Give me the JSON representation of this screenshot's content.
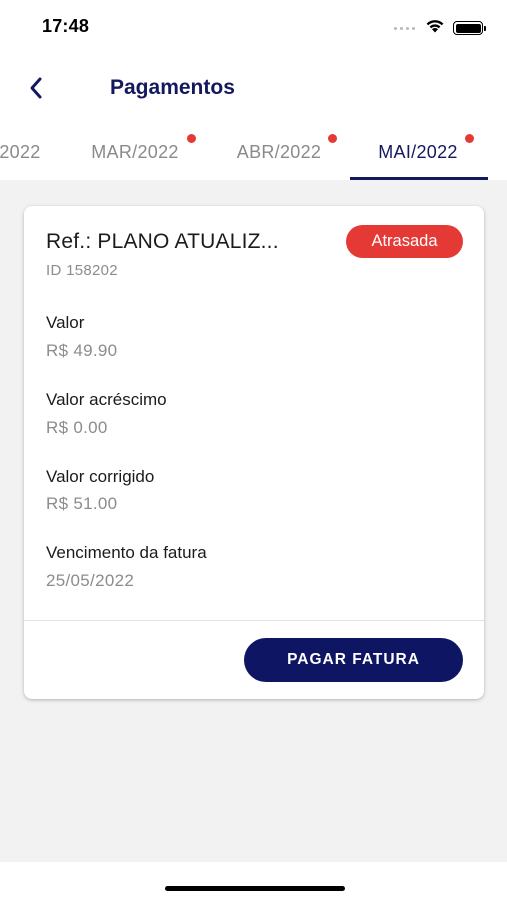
{
  "status_bar": {
    "time": "17:48",
    "icons": [
      "signal-dots-icon",
      "wifi-icon",
      "battery-icon"
    ]
  },
  "header": {
    "title": "Pagamentos",
    "back_icon": "chevron-left-icon"
  },
  "tabs": [
    {
      "label": "2022",
      "has_alert": false,
      "active": false
    },
    {
      "label": "MAR/2022",
      "has_alert": true,
      "active": false
    },
    {
      "label": "ABR/2022",
      "has_alert": true,
      "active": false
    },
    {
      "label": "MAI/2022",
      "has_alert": true,
      "active": true
    }
  ],
  "invoice": {
    "reference": "Ref.: PLANO ATUALIZ...",
    "status": "Atrasada",
    "id": "ID 158202",
    "fields": [
      {
        "label": "Valor",
        "value": "R$ 49.90"
      },
      {
        "label": "Valor acréscimo",
        "value": "R$ 0.00"
      },
      {
        "label": "Valor corrigido",
        "value": "R$ 51.00"
      },
      {
        "label": "Vencimento da fatura",
        "value": "25/05/2022"
      }
    ],
    "pay_button_label": "PAGAR FATURA"
  },
  "colors": {
    "primary": "#14195e",
    "button": "#0e1563",
    "alert": "#e53935",
    "muted_text": "#8c8c8c"
  }
}
